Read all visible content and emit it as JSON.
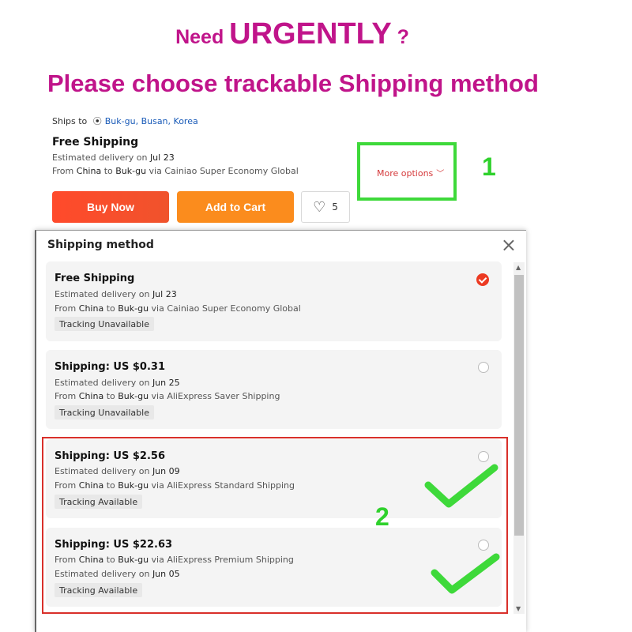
{
  "annotation": {
    "line1_prefix": "Need",
    "line1_big": "URGENTLY",
    "line1_suffix": "?",
    "line2": "Please choose trackable Shipping method",
    "step1": "1",
    "step2": "2",
    "highlight_color": "#c0148a",
    "marker_color": "#3ed93a",
    "box_color": "#d9302a"
  },
  "product": {
    "ships_to_label": "Ships to",
    "ships_to_location": "Buk-gu, Busan, Korea",
    "shipping_title": "Free Shipping",
    "delivery_prefix": "Estimated delivery on",
    "delivery_date": "Jul 23",
    "route_from": "From",
    "route_origin": "China",
    "route_to": "to",
    "route_dest": "Buk-gu",
    "route_via": "via Cainiao Super Economy Global",
    "more_options": "More options",
    "buy_now": "Buy Now",
    "add_to_cart": "Add to Cart",
    "wishlist_count": "5",
    "buy_color": "#ff4a2b",
    "cart_color": "#fb8c1d"
  },
  "modal": {
    "title": "Shipping method",
    "close": "×",
    "options": [
      {
        "title": "Free Shipping",
        "line1_prefix": "Estimated delivery on",
        "line1_value": "Jul 23",
        "line2_from": "From",
        "line2_origin": "China",
        "line2_to": "to",
        "line2_dest": "Buk-gu",
        "line2_via": "via Cainiao Super Economy Global",
        "tag": "Tracking Unavailable",
        "selected": true
      },
      {
        "title": "Shipping: US $0.31",
        "line1_prefix": "Estimated delivery on",
        "line1_value": "Jun 25",
        "line2_from": "From",
        "line2_origin": "China",
        "line2_to": "to",
        "line2_dest": "Buk-gu",
        "line2_via": "via AliExpress Saver Shipping",
        "tag": "Tracking Unavailable",
        "selected": false
      },
      {
        "title": "Shipping: US $2.56",
        "line1_prefix": "Estimated delivery on",
        "line1_value": "Jun 09",
        "line2_from": "From",
        "line2_origin": "China",
        "line2_to": "to",
        "line2_dest": "Buk-gu",
        "line2_via": "via AliExpress Standard Shipping",
        "tag": "Tracking Available",
        "selected": false
      },
      {
        "title": "Shipping: US $22.63",
        "line1_from": "From",
        "line1_origin": "China",
        "line1_to": "to",
        "line1_dest": "Buk-gu",
        "line1_via": "via AliExpress Premium Shipping",
        "line2_prefix": "Estimated delivery on",
        "line2_value": "Jun 05",
        "tag": "Tracking Available",
        "selected": false
      }
    ]
  }
}
